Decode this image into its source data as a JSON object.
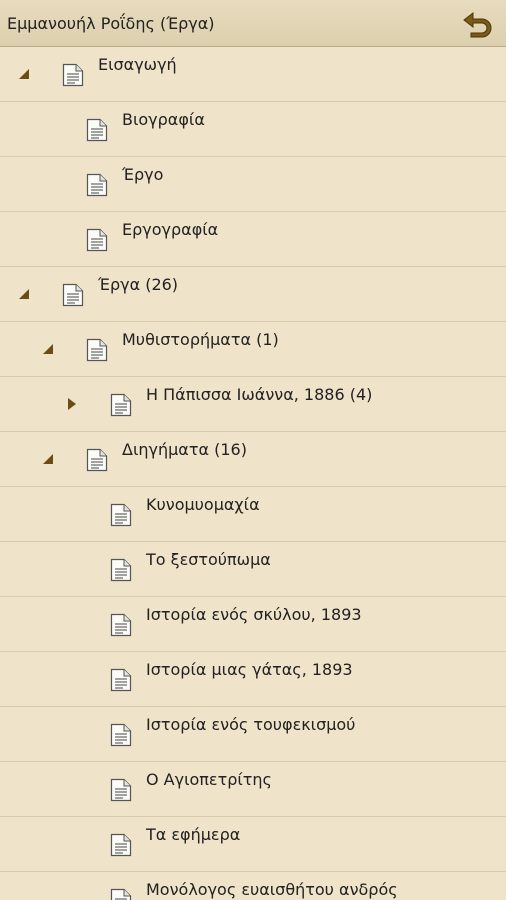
{
  "header": {
    "title": "Εμμανουήλ Ροΐδης (Έργα)",
    "back_icon": "undo-arrow-icon"
  },
  "colors": {
    "background": "#efe3c9",
    "arrow": "#6b4c12",
    "divider": "#d8cbae"
  },
  "tree": {
    "items": [
      {
        "label": "Εισαγωγή",
        "level": 0,
        "state": "expanded"
      },
      {
        "label": "Βιογραφία",
        "level": 1,
        "state": "leaf"
      },
      {
        "label": "Έργο",
        "level": 1,
        "state": "leaf"
      },
      {
        "label": "Εργογραφία",
        "level": 1,
        "state": "leaf"
      },
      {
        "label": "Έργα (26)",
        "level": 0,
        "state": "expanded"
      },
      {
        "label": "Μυθιστορήματα (1)",
        "level": 1,
        "state": "expanded"
      },
      {
        "label": "Η Πάπισσα Ιωάννα, 1886 (4)",
        "level": 2,
        "state": "collapsed"
      },
      {
        "label": "Διηγήματα (16)",
        "level": 1,
        "state": "expanded"
      },
      {
        "label": "Κυνομυομαχία",
        "level": 2,
        "state": "leaf"
      },
      {
        "label": "Το ξεστούπωμα",
        "level": 2,
        "state": "leaf"
      },
      {
        "label": "Ιστορία ενός σκύλου, 1893",
        "level": 2,
        "state": "leaf"
      },
      {
        "label": "Ιστορία μιας γάτας, 1893",
        "level": 2,
        "state": "leaf"
      },
      {
        "label": "Ιστορία ενός τουφεκισμού",
        "level": 2,
        "state": "leaf"
      },
      {
        "label": "Ο Αγιοπετρίτης",
        "level": 2,
        "state": "leaf"
      },
      {
        "label": "Τα εφήμερα",
        "level": 2,
        "state": "leaf"
      },
      {
        "label": "Μονόλογος ευαισθήτου ανδρός",
        "level": 2,
        "state": "leaf"
      }
    ]
  }
}
